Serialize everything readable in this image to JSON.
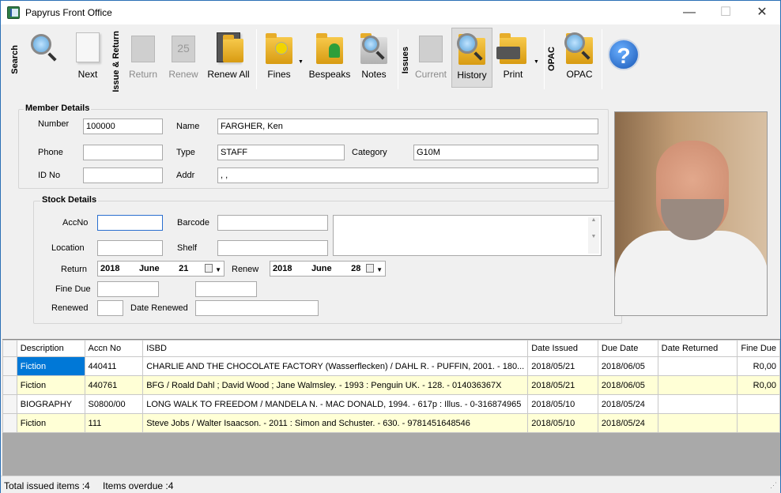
{
  "window": {
    "title": "Papyrus Front Office",
    "minimize": "—",
    "maximize": "☐",
    "close": "✕"
  },
  "toolbar": {
    "groups": {
      "search": "Search",
      "issue_return": "Issue & Return",
      "issues": "Issues",
      "opac": "OPAC"
    },
    "buttons": {
      "next": "Next",
      "return": "Return",
      "renew": "Renew",
      "renew_all": "Renew All",
      "fines": "Fines",
      "bespeaks": "Bespeaks",
      "notes": "Notes",
      "current": "Current",
      "history": "History",
      "print": "Print",
      "opac": "OPAC",
      "help": "?"
    },
    "calendar_day": "25"
  },
  "member": {
    "section_title": "Member Details",
    "labels": {
      "number": "Number",
      "name": "Name",
      "phone": "Phone",
      "type": "Type",
      "category": "Category",
      "id_no": "ID No",
      "addr": "Addr"
    },
    "values": {
      "number": "100000",
      "name": "FARGHER, Ken",
      "phone": "",
      "type": "STAFF",
      "category": "G10M",
      "id_no": "",
      "addr": ", ,"
    }
  },
  "stock": {
    "section_title": "Stock Details",
    "labels": {
      "accno": "AccNo",
      "barcode": "Barcode",
      "location": "Location",
      "shelf": "Shelf",
      "return": "Return",
      "renew": "Renew",
      "fine_due": "Fine Due",
      "renewed": "Renewed",
      "date_renewed": "Date Renewed"
    },
    "values": {
      "accno": "",
      "barcode": "",
      "location": "",
      "shelf": "",
      "fine_due": "",
      "fine_due2": "",
      "renewed": "",
      "date_renewed": "",
      "notes": ""
    },
    "return_date": {
      "year": "2018",
      "month": "June",
      "day": "21"
    },
    "renew_date": {
      "year": "2018",
      "month": "June",
      "day": "28"
    }
  },
  "table": {
    "headers": [
      "Description",
      "Accn No",
      "ISBD",
      "Date Issued",
      "Due Date",
      "Date Returned",
      "Fine Due"
    ],
    "rows": [
      [
        "Fiction",
        "440411",
        "CHARLIE AND THE CHOCOLATE FACTORY (Wasserflecken) / DAHL R. - PUFFIN, 2001. - 180...",
        "2018/05/21",
        "2018/06/05",
        "",
        "R0,00"
      ],
      [
        "Fiction",
        "440761",
        "BFG / Roald Dahl ; David Wood ; Jane Walmsley. - 1993 : Penguin UK. - 128. - 014036367X",
        "2018/05/21",
        "2018/06/05",
        "",
        "R0,00"
      ],
      [
        "BIOGRAPHY",
        "S0800/00",
        "LONG WALK TO FREEDOM / MANDELA N. - MAC DONALD, 1994. - 617p : Illus. - 0-316874965",
        "2018/05/10",
        "2018/05/24",
        "",
        ""
      ],
      [
        "Fiction",
        "111",
        "Steve Jobs / Walter Isaacson. - 2011 : Simon and Schuster. - 630. - 9781451648546",
        "2018/05/10",
        "2018/05/24",
        "",
        ""
      ]
    ]
  },
  "status": {
    "total_issued": "Total issued items :4",
    "overdue": "Items overdue :4"
  }
}
